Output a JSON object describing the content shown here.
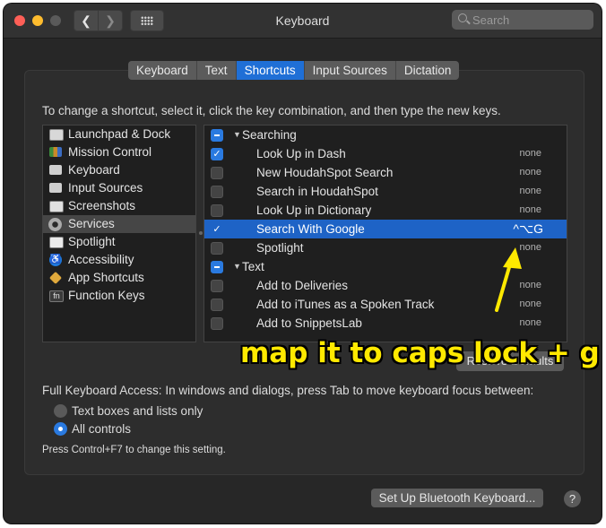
{
  "window": {
    "title": "Keyboard"
  },
  "toolbar": {
    "back": "❮",
    "forward": "❯",
    "search_placeholder": "Search"
  },
  "tabs": [
    "Keyboard",
    "Text",
    "Shortcuts",
    "Input Sources",
    "Dictation"
  ],
  "instructions": "To change a shortcut, select it, click the key combination, and then type the new keys.",
  "categories": [
    {
      "label": "Launchpad & Dock",
      "icon": "launchpad-icon"
    },
    {
      "label": "Mission Control",
      "icon": "mission-control-icon"
    },
    {
      "label": "Keyboard",
      "icon": "keyboard-icon"
    },
    {
      "label": "Input Sources",
      "icon": "input-sources-icon"
    },
    {
      "label": "Screenshots",
      "icon": "screenshot-icon"
    },
    {
      "label": "Services",
      "icon": "gear-icon"
    },
    {
      "label": "Spotlight",
      "icon": "spotlight-icon"
    },
    {
      "label": "Accessibility",
      "icon": "accessibility-icon"
    },
    {
      "label": "App Shortcuts",
      "icon": "app-shortcuts-icon"
    },
    {
      "label": "Function Keys",
      "icon": "fn-icon"
    }
  ],
  "shortcuts": {
    "group_searching": "Searching",
    "group_text": "Text",
    "rows": [
      {
        "label": "Look Up in Dash",
        "shortcut": "none",
        "checked": true
      },
      {
        "label": "New HoudahSpot Search",
        "shortcut": "none",
        "checked": false
      },
      {
        "label": "Search in HoudahSpot",
        "shortcut": "none",
        "checked": false
      },
      {
        "label": "Look Up in Dictionary",
        "shortcut": "none",
        "checked": false
      },
      {
        "label": "Search With Google",
        "shortcut": "^⌥G",
        "checked": true
      },
      {
        "label": "Spotlight",
        "shortcut": "none",
        "checked": false
      },
      {
        "label": "Add to Deliveries",
        "shortcut": "none",
        "checked": false
      },
      {
        "label": "Add to iTunes as a Spoken Track",
        "shortcut": "none",
        "checked": false
      },
      {
        "label": "Add to SnippetsLab",
        "shortcut": "none",
        "checked": false
      }
    ]
  },
  "restore_defaults": "Restore Defaults",
  "annotation": "map it to caps lock + g",
  "full_keyboard_access": "Full Keyboard Access: In windows and dialogs, press Tab to move keyboard focus between:",
  "radio_options": [
    "Text boxes and lists only",
    "All controls"
  ],
  "hint": "Press Control+F7 to change this setting.",
  "bluetooth_button": "Set Up Bluetooth Keyboard...",
  "help": "?",
  "colors": {
    "accent": "#1e63c6",
    "annotation": "#ffe900"
  }
}
